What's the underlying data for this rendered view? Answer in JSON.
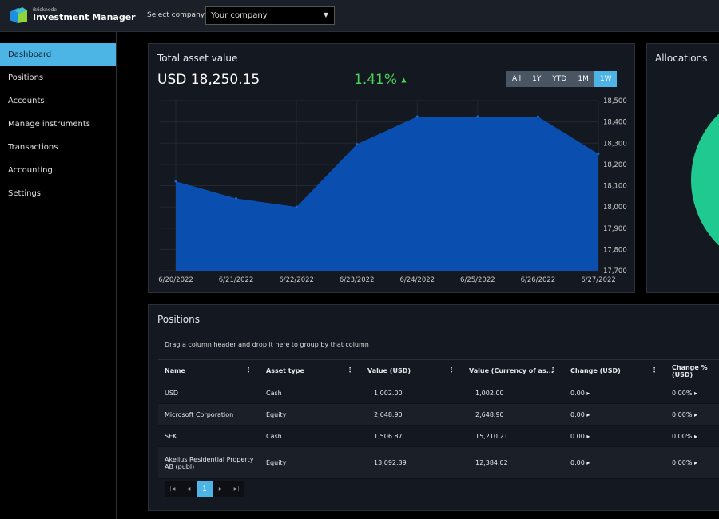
{
  "header": {
    "brand_small": "Bricknode",
    "brand": "Investment Manager",
    "select_label": "Select company:",
    "company": "Your company"
  },
  "sidebar": {
    "items": [
      {
        "label": "Dashboard",
        "active": true
      },
      {
        "label": "Positions"
      },
      {
        "label": "Accounts"
      },
      {
        "label": "Manage instruments"
      },
      {
        "label": "Transactions"
      },
      {
        "label": "Accounting"
      },
      {
        "label": "Settings"
      }
    ]
  },
  "asset": {
    "title": "Total asset value",
    "value": "USD 18,250.15",
    "change": "1.41%",
    "ranges": [
      "All",
      "1Y",
      "YTD",
      "1M",
      "1W"
    ],
    "active_range": "1W",
    "accent": "#4cb5e6",
    "up_color": "#4cd05c"
  },
  "chart_data": {
    "type": "area",
    "x": [
      "6/20/2022",
      "6/21/2022",
      "6/22/2022",
      "6/23/2022",
      "6/24/2022",
      "6/25/2022",
      "6/26/2022",
      "6/27/2022"
    ],
    "values": [
      18120,
      18040,
      18000,
      18295,
      18425,
      18425,
      18425,
      18250
    ],
    "ylim": [
      17700,
      18500
    ],
    "yticks": [
      "18,500",
      "18,400",
      "18,300",
      "18,200",
      "18,100",
      "18,000",
      "17,900",
      "17,800",
      "17,700"
    ],
    "color": "#0a4fb0",
    "grid": true
  },
  "allocations": {
    "title": "Allocations",
    "color": "#1fc98f"
  },
  "positions": {
    "title": "Positions",
    "group_hint": "Drag a column header and drop it here to group by that column",
    "columns": [
      "Name",
      "Asset type",
      "Value (USD)",
      "Value (Currency of as...",
      "Change (USD)",
      "Change % (USD)"
    ],
    "rows": [
      [
        "USD",
        "Cash",
        "1,002.00",
        "1,002.00",
        "0.00",
        "0.00%"
      ],
      [
        "Microsoft Corporation",
        "Equity",
        "2,648.90",
        "2,648.90",
        "0.00",
        "0.00%"
      ],
      [
        "SEK",
        "Cash",
        "1,506.87",
        "15,210.21",
        "0.00",
        "0.00%"
      ],
      [
        "Akelius Residential Property AB (publ)",
        "Equity",
        "13,092.39",
        "12,384.02",
        "0.00",
        "0.00%"
      ]
    ],
    "page": "1"
  }
}
